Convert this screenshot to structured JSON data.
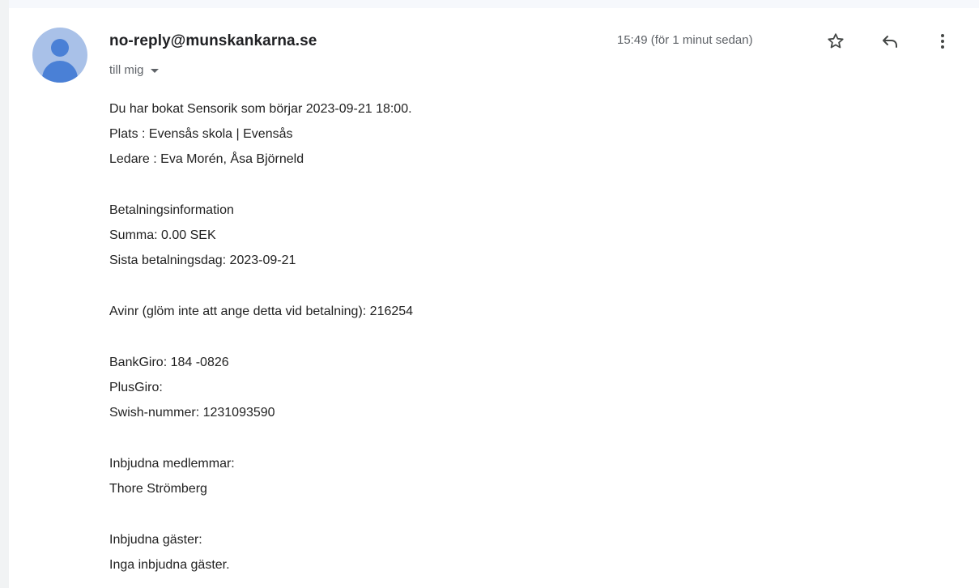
{
  "email": {
    "sender": "no-reply@munskankarna.se",
    "recipient": "till mig",
    "timestamp": "15:49 (för 1 minut sedan)"
  },
  "icons": {
    "avatar": "person-avatar-icon",
    "star": "star-icon",
    "reply": "reply-icon",
    "more": "more-vert-icon",
    "caret": "caret-down-icon"
  },
  "body": {
    "booking_line": "Du har bokat Sensorik som börjar 2023-09-21 18:00.",
    "place_line": "Plats : Evensås skola | Evensås",
    "leader_line": "Ledare : Eva Morén, Åsa Björneld",
    "payment_heading": "Betalningsinformation",
    "sum_line": "Summa: 0.00 SEK",
    "due_line": "Sista betalningsdag: 2023-09-21",
    "avinr_line": "Avinr (glöm inte att ange detta vid betalning): 216254",
    "bankgiro_line": "BankGiro: 184 -0826",
    "plusgiro_line": "PlusGiro:",
    "swish_line": "Swish-nummer: 1231093590",
    "members_heading": "Inbjudna medlemmar:",
    "members_line": "Thore Strömberg",
    "guests_heading": "Inbjudna gäster:",
    "guests_line": "Inga inbjudna gäster."
  },
  "colors": {
    "avatar_bg": "#a9c1e8",
    "avatar_fg": "#4a80d6",
    "text": "#222222",
    "muted": "#5f6368"
  }
}
